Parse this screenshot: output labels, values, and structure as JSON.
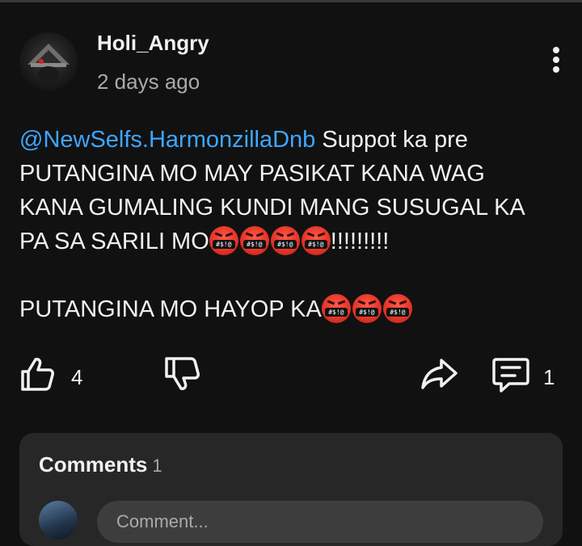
{
  "post": {
    "author": "Holi_Angry",
    "timestamp": "2 days ago",
    "mention": "@NewSelfs.HarmonzillaDnb",
    "line1_rest": " Suppot ka pre",
    "line2": "PUTANGINA MO MAY PASIKAT KANA WAG",
    "line3": "KANA GUMALING KUNDI MANG SUSUGAL KA",
    "line4_text": "PA SA SARILI MO",
    "line4_suffix": "!!!!!!!!!",
    "line5_text": "PUTANGINA MO HAYOP KA",
    "emoji_mouth": "#$!@"
  },
  "icons": {
    "more": "more-vert-icon",
    "like": "thumbs-up-icon",
    "dislike": "thumbs-down-icon",
    "share": "share-icon",
    "comment": "comment-icon",
    "emoji": "face-with-symbols-on-mouth-emoji"
  },
  "actions": {
    "like_count": "4",
    "comment_count": "1"
  },
  "comments": {
    "title": "Comments",
    "count": "1",
    "input_placeholder": "Comment..."
  },
  "colors": {
    "background": "#111111",
    "mention": "#3ea6ff",
    "panel": "#272727"
  }
}
